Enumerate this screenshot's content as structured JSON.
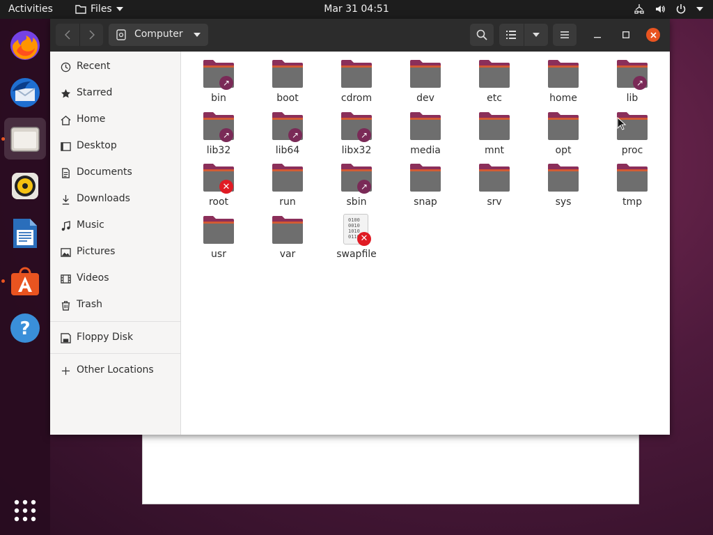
{
  "topbar": {
    "activities": "Activities",
    "app_name": "Files",
    "clock": "Mar 31  04:51"
  },
  "dock": {
    "apps": [
      {
        "name": "firefox",
        "running": false
      },
      {
        "name": "thunderbird",
        "running": false
      },
      {
        "name": "files",
        "running": true,
        "active": true
      },
      {
        "name": "rhythmbox",
        "running": false
      },
      {
        "name": "libreoffice-writer",
        "running": false
      },
      {
        "name": "ubuntu-software",
        "running": true
      },
      {
        "name": "help",
        "running": false
      }
    ]
  },
  "window": {
    "path_label": "Computer"
  },
  "sidebar": {
    "items": [
      {
        "label": "Recent",
        "icon": "clock-icon"
      },
      {
        "label": "Starred",
        "icon": "star-icon"
      },
      {
        "label": "Home",
        "icon": "home-icon"
      },
      {
        "label": "Desktop",
        "icon": "desktop-icon"
      },
      {
        "label": "Documents",
        "icon": "document-icon"
      },
      {
        "label": "Downloads",
        "icon": "download-icon"
      },
      {
        "label": "Music",
        "icon": "music-icon"
      },
      {
        "label": "Pictures",
        "icon": "picture-icon"
      },
      {
        "label": "Videos",
        "icon": "video-icon"
      },
      {
        "label": "Trash",
        "icon": "trash-icon"
      }
    ],
    "devices": [
      {
        "label": "Floppy Disk",
        "icon": "floppy-icon"
      }
    ],
    "other": {
      "label": "Other Locations",
      "icon": "plus-icon"
    }
  },
  "files": [
    {
      "name": "bin",
      "type": "folder",
      "emblem": "link"
    },
    {
      "name": "boot",
      "type": "folder",
      "emblem": ""
    },
    {
      "name": "cdrom",
      "type": "folder",
      "emblem": ""
    },
    {
      "name": "dev",
      "type": "folder",
      "emblem": ""
    },
    {
      "name": "etc",
      "type": "folder",
      "emblem": ""
    },
    {
      "name": "home",
      "type": "folder",
      "emblem": ""
    },
    {
      "name": "lib",
      "type": "folder",
      "emblem": "link"
    },
    {
      "name": "lib32",
      "type": "folder",
      "emblem": "link"
    },
    {
      "name": "lib64",
      "type": "folder",
      "emblem": "link"
    },
    {
      "name": "libx32",
      "type": "folder",
      "emblem": "link"
    },
    {
      "name": "media",
      "type": "folder",
      "emblem": ""
    },
    {
      "name": "mnt",
      "type": "folder",
      "emblem": ""
    },
    {
      "name": "opt",
      "type": "folder",
      "emblem": ""
    },
    {
      "name": "proc",
      "type": "folder",
      "emblem": ""
    },
    {
      "name": "root",
      "type": "folder",
      "emblem": "noaccess"
    },
    {
      "name": "run",
      "type": "folder",
      "emblem": ""
    },
    {
      "name": "sbin",
      "type": "folder",
      "emblem": "link"
    },
    {
      "name": "snap",
      "type": "folder",
      "emblem": ""
    },
    {
      "name": "srv",
      "type": "folder",
      "emblem": ""
    },
    {
      "name": "sys",
      "type": "folder",
      "emblem": ""
    },
    {
      "name": "tmp",
      "type": "folder",
      "emblem": ""
    },
    {
      "name": "usr",
      "type": "folder",
      "emblem": ""
    },
    {
      "name": "var",
      "type": "folder",
      "emblem": ""
    },
    {
      "name": "swapfile",
      "type": "binary",
      "emblem": "noaccess"
    }
  ],
  "colors": {
    "accent": "#e95420",
    "folder_body": "#6e6e6e",
    "folder_tab": "#8b2f5a",
    "link_emblem": "#7a2a57",
    "noaccess_emblem": "#e01b24"
  }
}
